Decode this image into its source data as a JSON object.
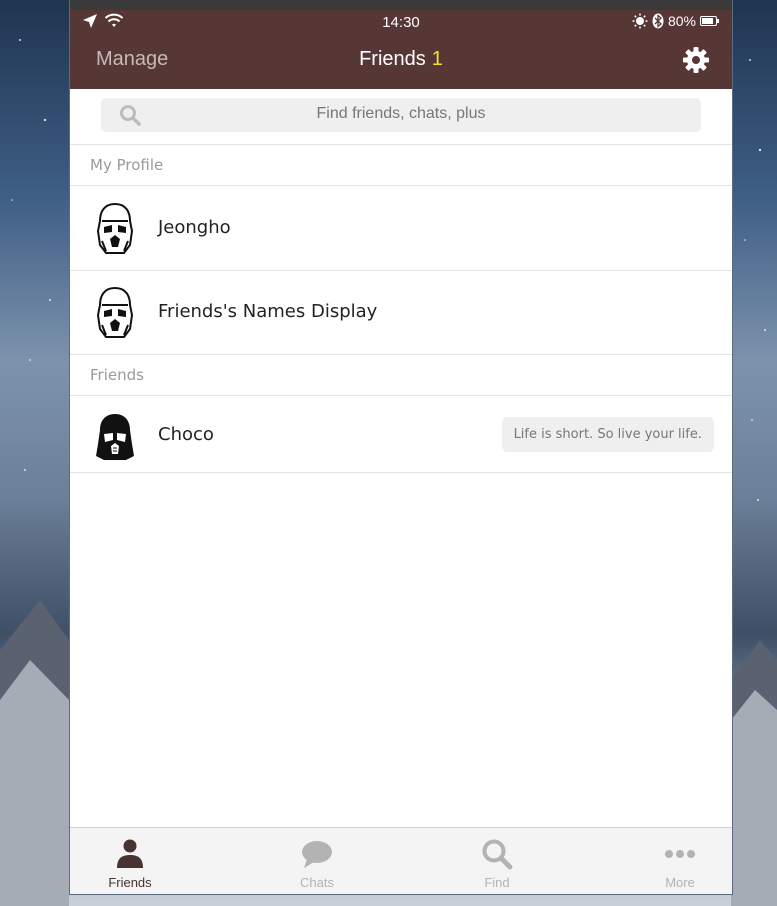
{
  "status_bar": {
    "time": "14:30",
    "battery": "80%"
  },
  "header": {
    "manage_label": "Manage",
    "title": "Friends",
    "count": "1"
  },
  "search": {
    "placeholder": "Find friends, chats, plus"
  },
  "sections": {
    "my_profile": "My Profile",
    "friends": "Friends"
  },
  "profile_items": [
    {
      "name": "Jeongho",
      "avatar": "stormtrooper-avatar"
    },
    {
      "name": "Friends's Names Display",
      "avatar": "stormtrooper-avatar"
    }
  ],
  "friends_items": [
    {
      "name": "Choco",
      "avatar": "darth-vader-avatar",
      "status_message": "Life is short. So live your life."
    }
  ],
  "tabbar": {
    "tabs": [
      {
        "label": "Friends",
        "icon": "person-icon",
        "active": true
      },
      {
        "label": "Chats",
        "icon": "chat-bubble-icon",
        "active": false
      },
      {
        "label": "Find",
        "icon": "search-icon",
        "active": false
      },
      {
        "label": "More",
        "icon": "more-dots-icon",
        "active": false
      }
    ]
  },
  "colors": {
    "header_bg": "#573735",
    "count_accent": "#f6e12a",
    "active_tab": "#473331",
    "inactive_tab": "#b3b3b3"
  }
}
